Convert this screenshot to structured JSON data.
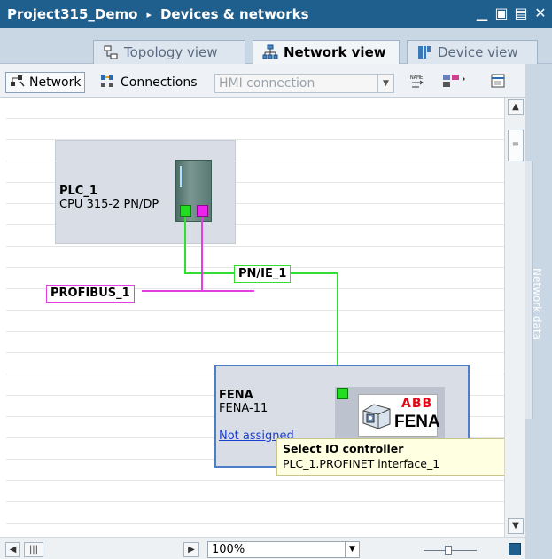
{
  "window": {
    "project": "Project315_Demo",
    "breadcrumb_separator": "▸",
    "section": "Devices & networks",
    "title_color": "#1f5f8e"
  },
  "tabs": [
    {
      "label": "Topology view",
      "active": false,
      "icon": "topology-icon"
    },
    {
      "label": "Network view",
      "active": true,
      "icon": "network-icon"
    },
    {
      "label": "Device view",
      "active": false,
      "icon": "device-icon"
    }
  ],
  "toolbar": {
    "network_label": "Network",
    "connections_label": "Connections",
    "connection_type_value": "HMI connection"
  },
  "devices": {
    "plc": {
      "name": "PLC_1",
      "type": "CPU 315-2 PN/DP"
    },
    "fena": {
      "name": "FENA",
      "type": "FENA-11",
      "link_text": "Not assigned",
      "logo_brand": "ABB",
      "logo_text": "FENA"
    }
  },
  "networks": {
    "profinet_label": "PN/IE_1",
    "profibus_label": "PROFIBUS_1",
    "profinet_color": "#2ecc40",
    "profibus_color": "#e040e0"
  },
  "tooltip": {
    "title": "Select IO controller",
    "value": "PLC_1.PROFINET interface_1"
  },
  "side_panel": {
    "label": "Network data"
  },
  "statusbar": {
    "zoom": "100%"
  }
}
